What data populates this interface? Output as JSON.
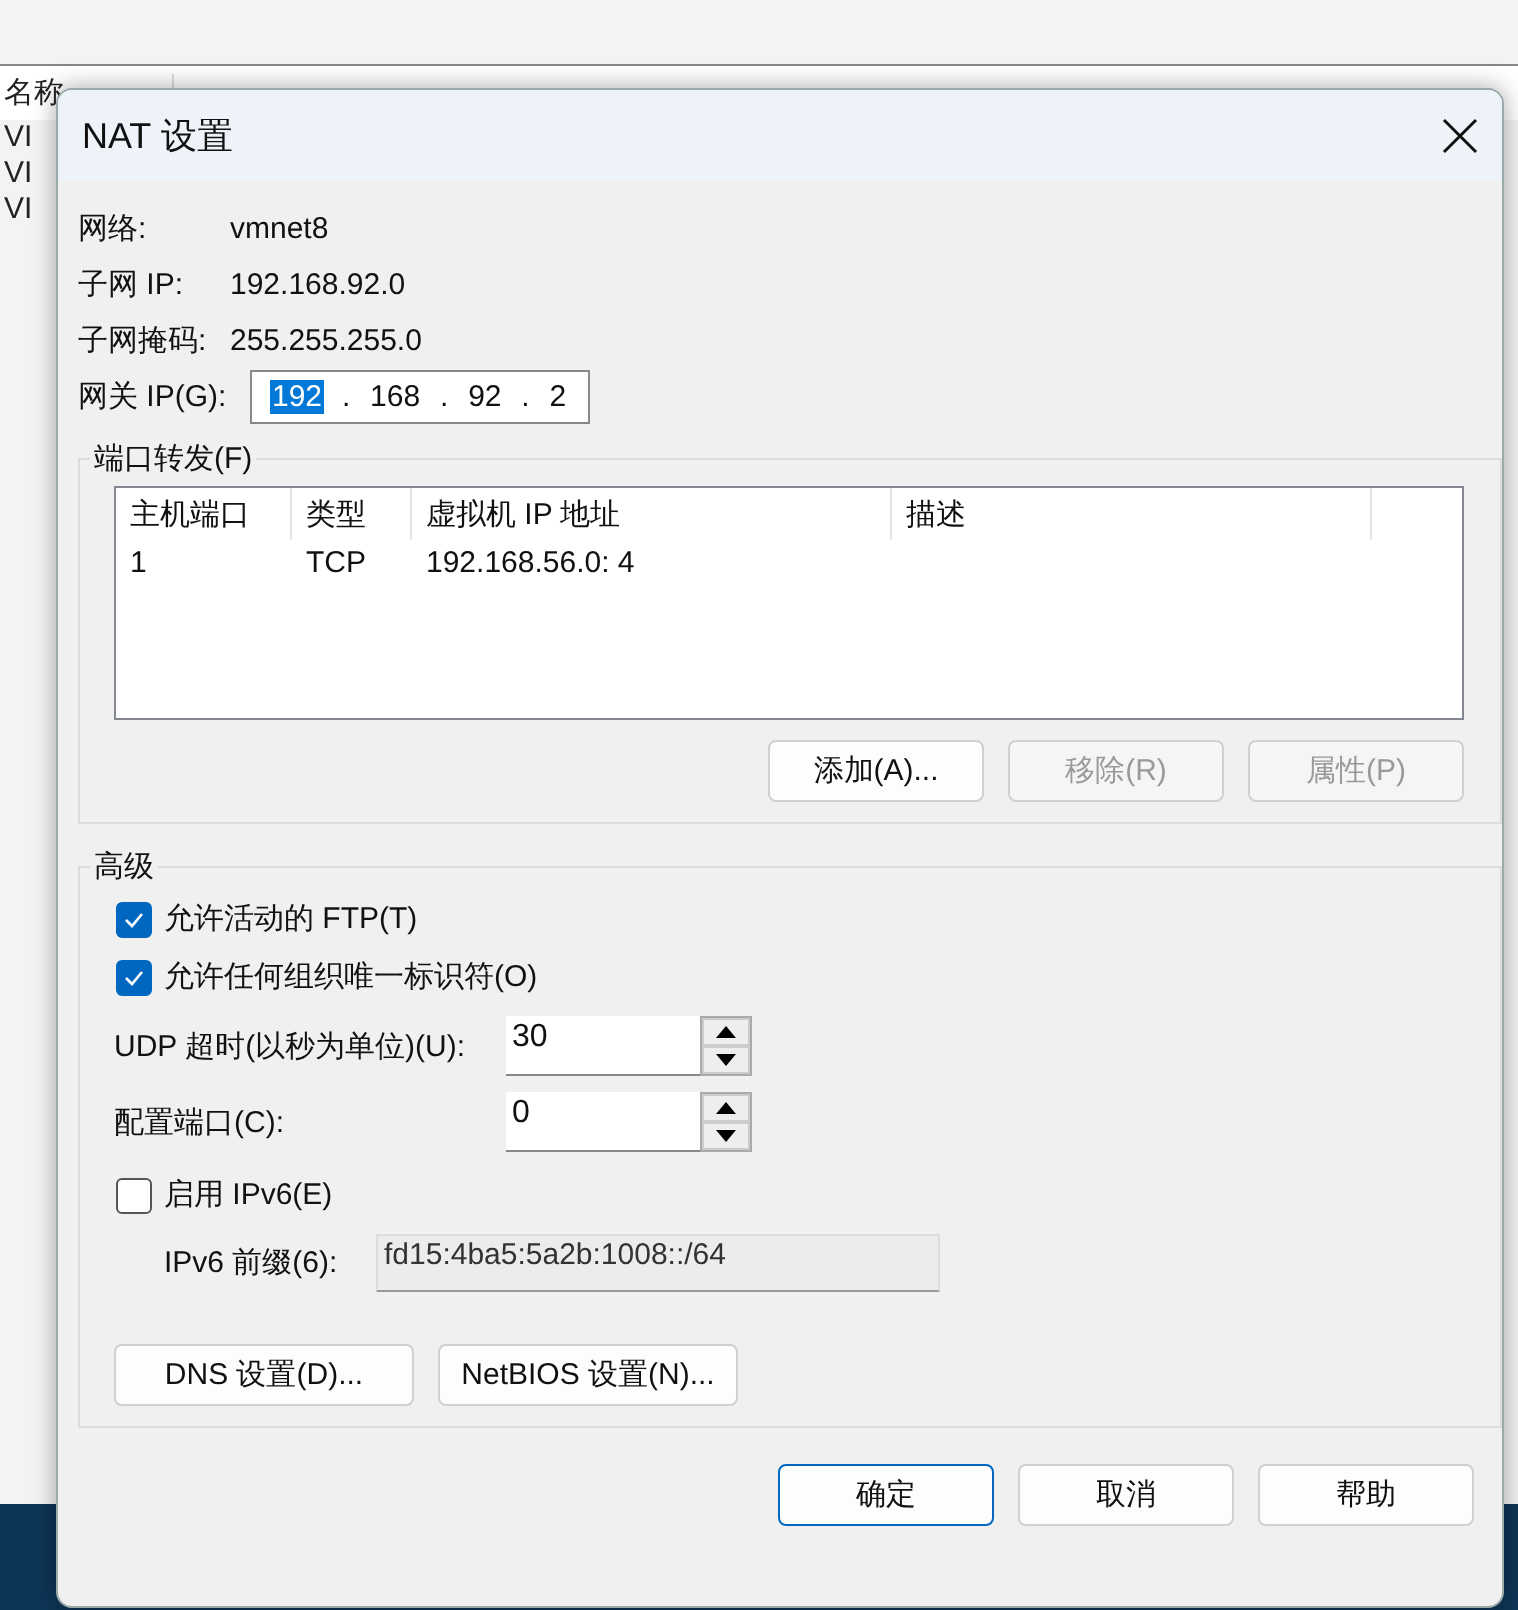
{
  "parent_window": {
    "columns": [
      "名称"
    ],
    "row_fragments": [
      "VI",
      "VI",
      "VI"
    ]
  },
  "dialog": {
    "title": "NAT 设置",
    "info": [
      {
        "label": "网络:",
        "value": "vmnet8"
      },
      {
        "label": "子网 IP:",
        "value": "192.168.92.0"
      },
      {
        "label": "子网掩码:",
        "value": "255.255.255.0"
      }
    ],
    "gateway": {
      "label": "网关 IP(G):",
      "separator": ".",
      "octets": [
        {
          "text": "192",
          "selected": true
        },
        {
          "text": "168",
          "selected": false
        },
        {
          "text": "92",
          "selected": false
        },
        {
          "text": "2",
          "selected": false
        }
      ]
    },
    "port_forwarding": {
      "title": "端口转发(F)",
      "columns": [
        "主机端口",
        "类型",
        "虚拟机 IP 地址",
        "描述"
      ],
      "rows": [
        [
          "1",
          "TCP",
          "192.168.56.0: 4"
        ]
      ],
      "buttons": [
        {
          "label": "添加(A)...",
          "disabled": false
        },
        {
          "label": "移除(R)",
          "disabled": true
        },
        {
          "label": "属性(P)",
          "disabled": true
        }
      ]
    },
    "advanced": {
      "title": "高级",
      "checkboxes": [
        {
          "label": "允许活动的 FTP(T)",
          "checked": true
        },
        {
          "label": "允许任何组织唯一标识符(O)",
          "checked": true
        }
      ],
      "spinners": [
        {
          "label": "UDP 超时(以秒为单位)(U):",
          "value": "30"
        },
        {
          "label": "配置端口(C):",
          "value": "0"
        }
      ],
      "ipv6": {
        "label": "启用 IPv6(E)",
        "checked": false
      },
      "prefix": {
        "label": "IPv6 前缀(6):",
        "value": "fd15:4ba5:5a2b:1008::/64",
        "disabled": true
      },
      "buttons": [
        "DNS 设置(D)...",
        "NetBIOS 设置(N)..."
      ]
    },
    "footer_buttons": [
      {
        "label": "确定",
        "default": true
      },
      {
        "label": "取消",
        "default": false
      },
      {
        "label": "帮助",
        "default": false
      }
    ]
  }
}
